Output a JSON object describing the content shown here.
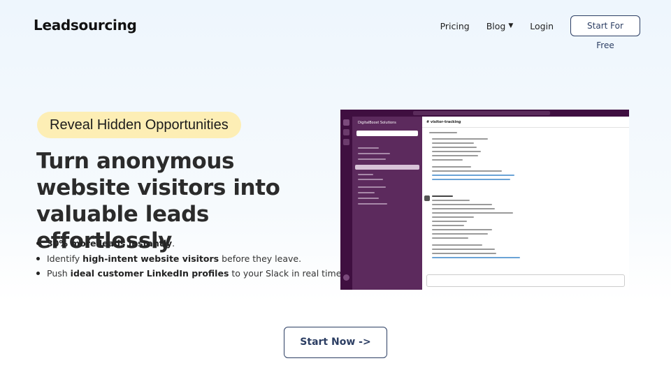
{
  "header": {
    "logo": "Leadsourcing",
    "nav": {
      "pricing": "Pricing",
      "blog": "Blog",
      "login": "Login"
    },
    "cta_label": "Start For Free"
  },
  "hero": {
    "badge": "Reveal Hidden Opportunities",
    "title": "Turn anonymous website visitors into valuable leads effortlessly",
    "bullets": [
      {
        "bold": "30% more leads instantly",
        "after": "."
      },
      {
        "before": "Identify ",
        "bold": "high-intent website visitors",
        "after": " before they leave."
      },
      {
        "before": "Push ",
        "bold": "ideal customer LinkedIn profiles",
        "after": " to your Slack in real time."
      }
    ]
  },
  "screenshot": {
    "workspace": "DigitalBoost Solutions",
    "channel": "# visitor-tracking"
  },
  "cta": {
    "label": "Start Now ->"
  },
  "colors": {
    "brand_navy": "#2c3e63",
    "badge_bg": "#fdeeb5",
    "slack_dark": "#3f0f40",
    "slack_side": "#5c2a5d"
  }
}
